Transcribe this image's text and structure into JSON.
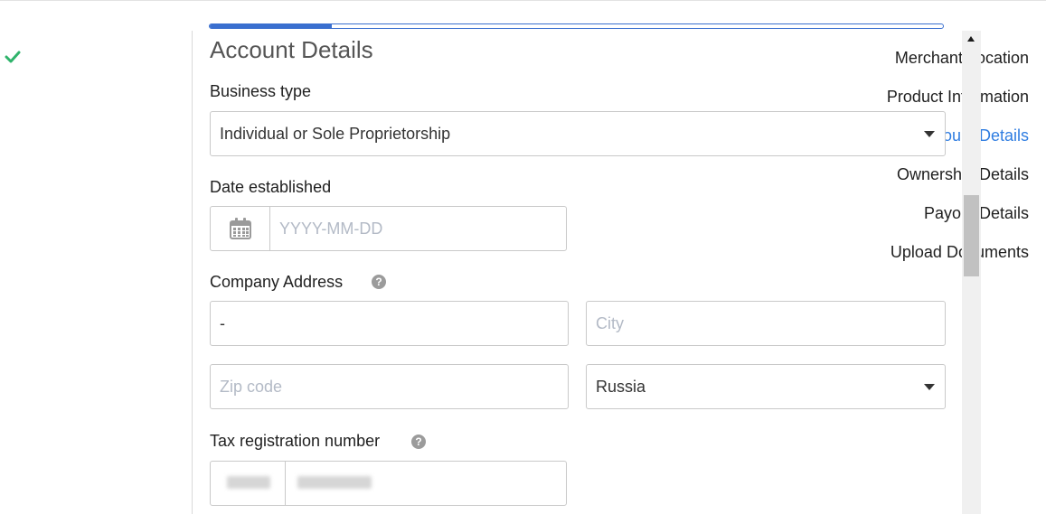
{
  "steps": {
    "items": [
      {
        "label": "Merchant Location",
        "status": "completed"
      },
      {
        "label": "Product Information",
        "status": "pending"
      },
      {
        "label": "Account Details",
        "status": "active"
      },
      {
        "label": "Ownership Details",
        "status": "pending"
      },
      {
        "label": "Payout Details",
        "status": "pending"
      },
      {
        "label": "Upload Documents",
        "status": "pending"
      }
    ]
  },
  "progress": {
    "fraction": 0.166
  },
  "form": {
    "title": "Account Details",
    "business_type": {
      "label": "Business type",
      "value": "Individual or Sole Proprietorship"
    },
    "date_established": {
      "label": "Date established",
      "placeholder": "YYYY-MM-DD"
    },
    "company_address": {
      "label": "Company Address",
      "help": "?",
      "street_value": "-",
      "city_placeholder": "City",
      "zip_placeholder": "Zip code",
      "country_value": "Russia"
    },
    "tax_registration": {
      "label": "Tax registration number",
      "help": "?"
    }
  },
  "colors": {
    "accent": "#2f7de1",
    "check": "#2fb36b",
    "placeholder": "#b3bac6",
    "progress": "#3a6fcf"
  },
  "icons": {
    "completed": "check-icon",
    "calendar": "calendar-icon",
    "help": "help-icon",
    "dropdown": "caret-down-icon"
  }
}
